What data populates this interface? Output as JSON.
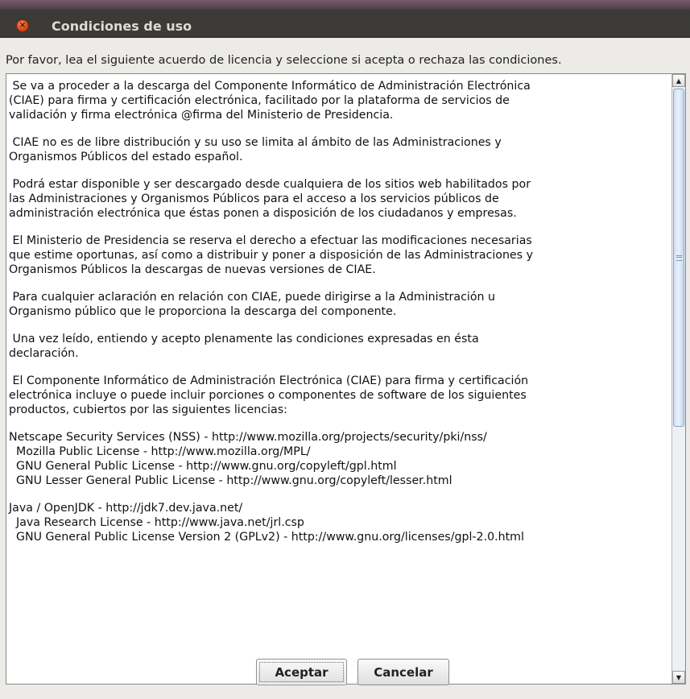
{
  "window": {
    "title": "Condiciones de uso",
    "close_glyph": "×"
  },
  "dialog": {
    "prompt": "Por favor, lea el siguiente acuerdo de licencia y seleccione si acepta o rechaza las condiciones.",
    "license_paragraphs": [
      " Se va a proceder a la descarga del Componente Informático de Administración Electrónica\n(CIAE) para firma y certificación electrónica, facilitado por la plataforma de servicios de\nvalidación y firma electrónica @firma del Ministerio de Presidencia.",
      " CIAE no es de libre distribución y su uso se limita al ámbito de las Administraciones y\nOrganismos Públicos del estado español.",
      " Podrá estar disponible y ser descargado desde cualquiera de los sitios web habilitados por\nlas Administraciones y Organismos Públicos para el acceso a los servicios públicos de\nadministración electrónica que éstas ponen a disposición de los ciudadanos y empresas.",
      " El Ministerio de Presidencia se reserva el derecho a efectuar las modificaciones necesarias\nque estime oportunas, así como a distribuir y poner a disposición de las Administraciones y\nOrganismos Públicos la descargas de nuevas versiones de CIAE.",
      " Para cualquier aclaración en relación con CIAE, puede dirigirse a la Administración u\nOrganismo público que le proporciona la descarga del componente.",
      " Una vez leído, entiendo y acepto plenamente las condiciones expresadas en ésta\ndeclaración.",
      " El Componente Informático de Administración Electrónica (CIAE) para firma y certificación\nelectrónica incluye o puede incluir porciones o componentes de software de los siguientes\nproductos, cubiertos por las siguientes licencias:",
      "Netscape Security Services (NSS) - http://www.mozilla.org/projects/security/pki/nss/\n  Mozilla Public License - http://www.mozilla.org/MPL/\n  GNU General Public License - http://www.gnu.org/copyleft/gpl.html\n  GNU Lesser General Public License - http://www.gnu.org/copyleft/lesser.html",
      "Java / OpenJDK - http://jdk7.dev.java.net/\n  Java Research License - http://www.java.net/jrl.csp\n  GNU General Public License Version 2 (GPLv2) - http://www.gnu.org/licenses/gpl-2.0.html"
    ],
    "scroll_up_glyph": "▲",
    "scroll_down_glyph": "▼"
  },
  "buttons": {
    "accept_label": "Aceptar",
    "cancel_label": "Cancelar"
  },
  "colors": {
    "titlebar": "#3c3b37",
    "close_button": "#df4b16",
    "dialog_bg": "#ecebe8"
  }
}
